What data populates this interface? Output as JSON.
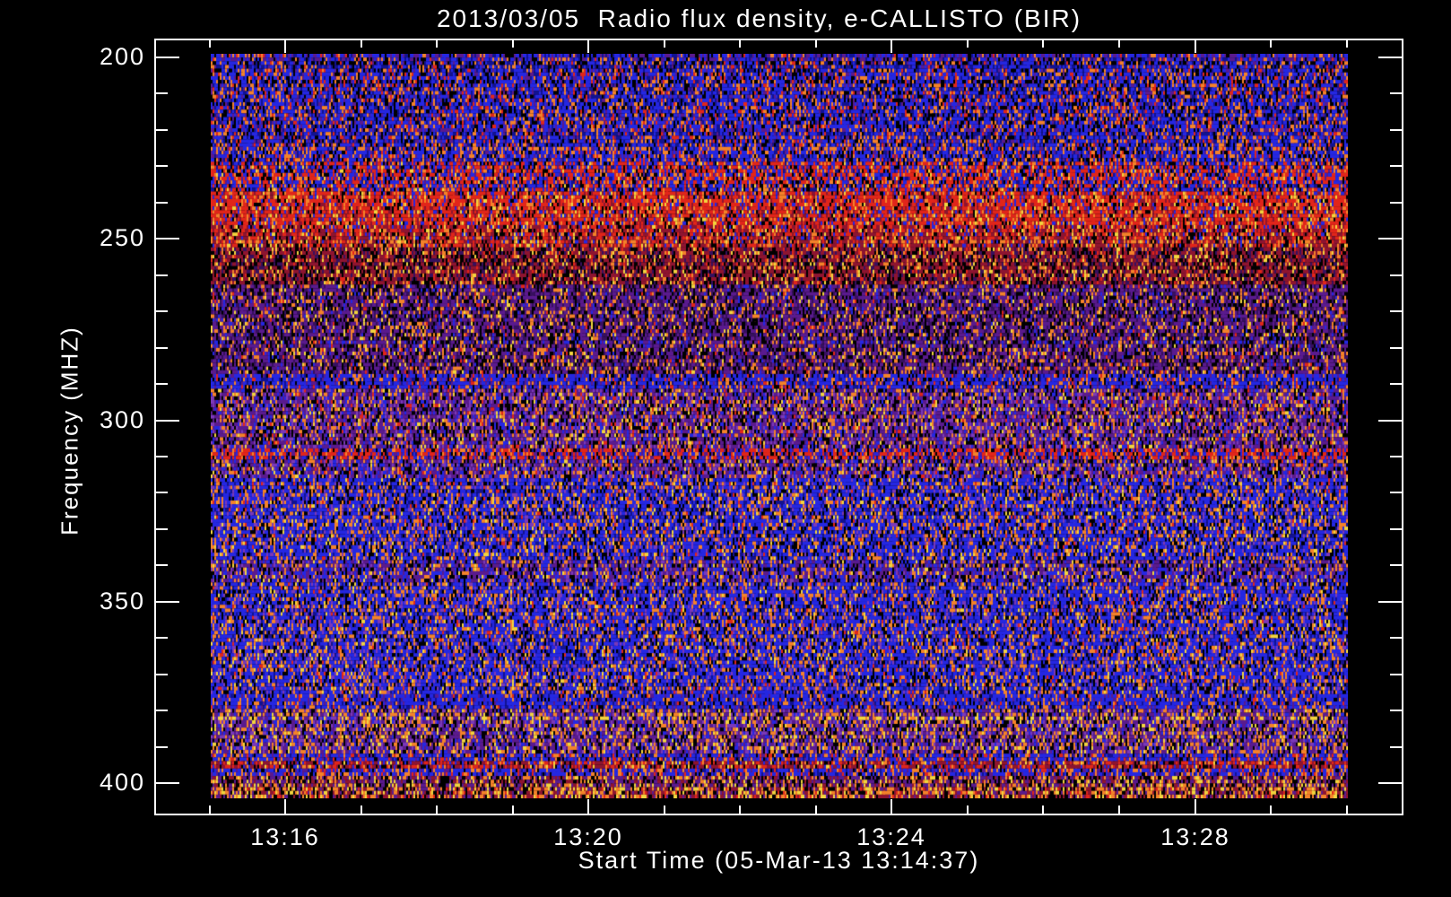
{
  "page": {
    "background": "#000000",
    "foreground": "#ffffff"
  },
  "chart_data": {
    "type": "heatmap",
    "title": "2013/03/05  Radio flux density, e-CALLISTO (BIR)",
    "date": "2013/03/05",
    "instrument": "e-CALLISTO (BIR)",
    "xlabel": "Start Time (05-Mar-13 13:14:37)",
    "ylabel": "Frequency (MHZ)",
    "start_time": "05-Mar-13 13:14:37",
    "axis_color": "#ffffff",
    "plot_background": "#000000",
    "legend": "none",
    "grid": "off",
    "x_axis": {
      "major_ticks": [
        {
          "label": "13:16",
          "minutes_after_1300": 16
        },
        {
          "label": "13:20",
          "minutes_after_1300": 20
        },
        {
          "label": "13:24",
          "minutes_after_1300": 24
        },
        {
          "label": "13:28",
          "minutes_after_1300": 28
        }
      ],
      "minor_tick_minutes": [
        15,
        17,
        18,
        19,
        21,
        22,
        23,
        25,
        26,
        27,
        29,
        30
      ],
      "range_minutes_after_1300": [
        14.27,
        30.75
      ]
    },
    "y_axis": {
      "major_ticks": [
        200,
        250,
        300,
        350,
        400
      ],
      "minor_ticks": [
        210,
        220,
        230,
        240,
        260,
        270,
        280,
        290,
        310,
        320,
        330,
        340,
        360,
        370,
        380,
        390
      ],
      "range_mhz": [
        194.8,
        408.9
      ],
      "inverted": true
    },
    "data_extent": {
      "freq_mhz": [
        199,
        404.5
      ]
    },
    "palette_colors": {
      "blue": "#2527e2",
      "navy": "#121291",
      "black": "#000000",
      "orange": "#f4822a",
      "yellow": "#f2d43e",
      "red": "#e1251a",
      "darkred": "#8e1430",
      "purple": "#5a1a8e",
      "violet": "#7b39b8",
      "dkpurple": "#37105e"
    },
    "bands": [
      {
        "f0": 199.0,
        "f1": 201.5,
        "note": "purple top rows",
        "palette": {
          "purple": 0.3,
          "blue": 0.28,
          "navy": 0.15,
          "black": 0.12,
          "orange": 0.1,
          "red": 0.05
        }
      },
      {
        "f0": 201.5,
        "f1": 229.0,
        "note": "blue noise, orange speckle",
        "palette": {
          "blue": 0.4,
          "navy": 0.12,
          "black": 0.17,
          "orange": 0.15,
          "red": 0.08,
          "purple": 0.08
        }
      },
      {
        "f0": 229.0,
        "f1": 234.5,
        "note": "red interference line ~232 MHz",
        "palette": {
          "red": 0.34,
          "blue": 0.26,
          "black": 0.13,
          "orange": 0.13,
          "navy": 0.07,
          "yellow": 0.03,
          "purple": 0.04
        }
      },
      {
        "f0": 234.5,
        "f1": 237.5,
        "note": "blue-red mix",
        "palette": {
          "blue": 0.32,
          "red": 0.24,
          "black": 0.14,
          "navy": 0.1,
          "orange": 0.14,
          "yellow": 0.03,
          "purple": 0.03
        }
      },
      {
        "f0": 237.5,
        "f1": 246.0,
        "note": "strong red band",
        "palette": {
          "red": 0.47,
          "darkred": 0.13,
          "black": 0.1,
          "blue": 0.11,
          "orange": 0.13,
          "yellow": 0.06
        }
      },
      {
        "f0": 246.0,
        "f1": 252.0,
        "note": "dark red band",
        "palette": {
          "red": 0.28,
          "darkred": 0.32,
          "black": 0.14,
          "blue": 0.08,
          "orange": 0.12,
          "yellow": 0.06
        }
      },
      {
        "f0": 252.0,
        "f1": 263.0,
        "note": "dark maroon",
        "palette": {
          "darkred": 0.38,
          "black": 0.24,
          "dkpurple": 0.16,
          "orange": 0.11,
          "red": 0.05,
          "yellow": 0.06
        }
      },
      {
        "f0": 263.0,
        "f1": 287.0,
        "note": "dark purple, speckles",
        "palette": {
          "purple": 0.36,
          "black": 0.22,
          "dkpurple": 0.16,
          "orange": 0.13,
          "blue": 0.06,
          "yellow": 0.04,
          "red": 0.03
        }
      },
      {
        "f0": 287.0,
        "f1": 291.0,
        "note": "blue stripes ~288 MHz",
        "palette": {
          "blue": 0.52,
          "black": 0.12,
          "navy": 0.09,
          "orange": 0.11,
          "purple": 0.1,
          "red": 0.06
        }
      },
      {
        "f0": 291.0,
        "f1": 308.0,
        "note": "violet noise",
        "palette": {
          "purple": 0.33,
          "violet": 0.14,
          "black": 0.18,
          "orange": 0.13,
          "blue": 0.13,
          "yellow": 0.05,
          "red": 0.04
        }
      },
      {
        "f0": 308.0,
        "f1": 311.5,
        "note": "red line ~310 MHz",
        "palette": {
          "red": 0.38,
          "blue": 0.2,
          "purple": 0.11,
          "black": 0.12,
          "orange": 0.13,
          "navy": 0.06
        }
      },
      {
        "f0": 311.5,
        "f1": 316.0,
        "note": "violet noise",
        "palette": {
          "purple": 0.3,
          "violet": 0.13,
          "black": 0.17,
          "orange": 0.13,
          "blue": 0.2,
          "yellow": 0.04,
          "red": 0.03
        }
      },
      {
        "f0": 316.0,
        "f1": 339.0,
        "note": "bright blue noise",
        "palette": {
          "blue": 0.45,
          "navy": 0.09,
          "black": 0.14,
          "orange": 0.16,
          "violet": 0.09,
          "yellow": 0.04,
          "red": 0.03
        }
      },
      {
        "f0": 339.0,
        "f1": 344.5,
        "note": "darker purple band ~341 MHz",
        "palette": {
          "purple": 0.3,
          "blue": 0.27,
          "black": 0.18,
          "orange": 0.14,
          "violet": 0.07,
          "yellow": 0.04
        }
      },
      {
        "f0": 344.5,
        "f1": 376.0,
        "note": "bright blue noise",
        "palette": {
          "blue": 0.44,
          "navy": 0.09,
          "black": 0.14,
          "orange": 0.16,
          "violet": 0.1,
          "yellow": 0.04,
          "red": 0.03
        }
      },
      {
        "f0": 376.0,
        "f1": 379.5,
        "note": "blue stripe ~377 MHz",
        "palette": {
          "blue": 0.54,
          "navy": 0.1,
          "black": 0.1,
          "orange": 0.14,
          "purple": 0.08,
          "red": 0.04
        }
      },
      {
        "f0": 379.5,
        "f1": 392.0,
        "note": "purple, heavy yellow speckle",
        "palette": {
          "purple": 0.3,
          "violet": 0.13,
          "black": 0.17,
          "orange": 0.19,
          "yellow": 0.08,
          "blue": 0.13
        }
      },
      {
        "f0": 392.0,
        "f1": 394.0,
        "note": "blue stripe ~393 MHz",
        "palette": {
          "blue": 0.48,
          "navy": 0.09,
          "black": 0.1,
          "orange": 0.14,
          "red": 0.1,
          "purple": 0.09
        }
      },
      {
        "f0": 394.0,
        "f1": 396.5,
        "note": "dark red line ~395 MHz",
        "palette": {
          "darkred": 0.33,
          "red": 0.24,
          "black": 0.12,
          "blue": 0.13,
          "orange": 0.11,
          "yellow": 0.07
        }
      },
      {
        "f0": 396.5,
        "f1": 398.5,
        "note": "blue stripe ~397 MHz",
        "palette": {
          "blue": 0.42,
          "navy": 0.09,
          "black": 0.12,
          "orange": 0.16,
          "red": 0.09,
          "purple": 0.12
        }
      },
      {
        "f0": 398.5,
        "f1": 401.5,
        "note": "dark purple band",
        "palette": {
          "purple": 0.32,
          "black": 0.24,
          "darkred": 0.16,
          "orange": 0.16,
          "yellow": 0.12
        }
      },
      {
        "f0": 401.5,
        "f1": 404.5,
        "note": "bottom speckle band",
        "palette": {
          "black": 0.2,
          "darkred": 0.2,
          "purple": 0.15,
          "orange": 0.23,
          "yellow": 0.16,
          "red": 0.06
        }
      }
    ]
  }
}
